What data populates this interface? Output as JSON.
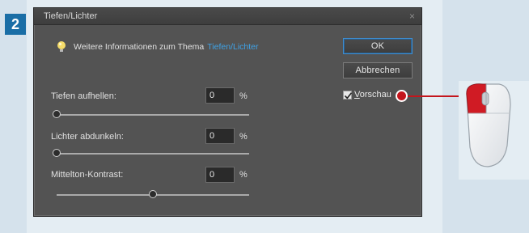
{
  "step": {
    "number": "2"
  },
  "dialog": {
    "title": "Tiefen/Lichter",
    "close": "×",
    "info_text": "Weitere Informationen zum Thema",
    "info_link": "Tiefen/Lichter",
    "ok_label": "OK",
    "cancel_label": "Abbrechen",
    "preview": {
      "label_underlined": "V",
      "label_rest": "orschau",
      "checked": true
    },
    "sliders": [
      {
        "label": "Tiefen aufhellen:",
        "value": "0",
        "unit": "%",
        "level": 0
      },
      {
        "label": "Lichter abdunkeln:",
        "value": "0",
        "unit": "%",
        "level": 0
      },
      {
        "label": "Mittelton-Kontrast:",
        "value": "0",
        "unit": "%",
        "level": 0.5
      }
    ]
  },
  "colors": {
    "accent_blue": "#3fa2e6",
    "callout_red": "#c4151c",
    "step_badge": "#1a6ea6"
  },
  "icons": [
    "lightbulb-icon",
    "checkmark-icon",
    "mouse-icon",
    "close-icon"
  ]
}
